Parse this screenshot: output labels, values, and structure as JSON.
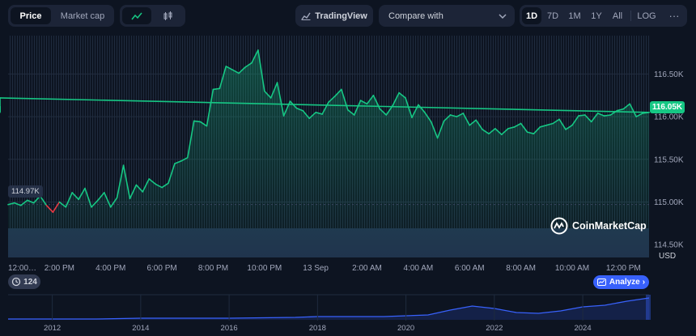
{
  "toolbar": {
    "price_tab": "Price",
    "marketcap_tab": "Market cap",
    "chart_type_line_icon": "line-chart-icon",
    "chart_type_candle_icon": "candlestick-icon",
    "tradingview_label": "TradingView",
    "compare_placeholder": "Compare with",
    "ranges": [
      "1D",
      "7D",
      "1M",
      "1Y",
      "All"
    ],
    "active_range": "1D",
    "log_label": "LOG",
    "more_icon": "more-icon"
  },
  "watermark": "CoinMarketCap",
  "history_badge": "124",
  "analyze_button": "Analyze",
  "colors": {
    "up": "#16c784",
    "down": "#ea3943",
    "background": "#0d1421",
    "volume": "#3d5a80",
    "accent": "#3861fb"
  },
  "chart_data": {
    "type": "area",
    "currency_label": "USD",
    "y_ticks": [
      "116.50K",
      "116.00K",
      "115.50K",
      "115.00K",
      "114.50K"
    ],
    "y_tick_values": [
      116500,
      116000,
      115500,
      115000,
      114500
    ],
    "ylim": [
      114350,
      116950
    ],
    "x_tick_labels": [
      "12:00…",
      "2:00 PM",
      "4:00 PM",
      "6:00 PM",
      "8:00 PM",
      "10:00 PM",
      "13 Sep",
      "2:00 AM",
      "4:00 AM",
      "6:00 AM",
      "8:00 AM",
      "10:00 AM",
      "12:00 PM"
    ],
    "x_tick_hours": [
      0,
      2,
      4,
      6,
      8,
      10,
      12,
      14,
      16,
      18,
      20,
      22,
      24
    ],
    "open_price_label": "114.97K",
    "open_price": 114970,
    "current_price_label": "116.05K",
    "current_price": 116050,
    "series": [
      {
        "hours": [
          0,
          0.25,
          0.5,
          0.75,
          1,
          1.25,
          1.5,
          1.75,
          2,
          2.25,
          2.5,
          2.75,
          3,
          3.25,
          3.5,
          3.75,
          4,
          4.25,
          4.5,
          4.75,
          5,
          5.25,
          5.5,
          5.75,
          6,
          6.25,
          6.5,
          6.75,
          7,
          7.25,
          7.5,
          7.75,
          8,
          8.25,
          8.5,
          8.75,
          9,
          9.25,
          9.5,
          9.75,
          10,
          10.25,
          10.5,
          10.75,
          11,
          11.25,
          11.5,
          11.75,
          12,
          12.25,
          12.5,
          12.75,
          13,
          13.25,
          13.5,
          13.75,
          14,
          14.25,
          14.5,
          14.75,
          15,
          15.25,
          15.5,
          15.75,
          16,
          16.25,
          16.5,
          16.75,
          17,
          17.25,
          17.5,
          17.75,
          18,
          18.25,
          18.5,
          18.75,
          19,
          19.25,
          19.5,
          19.75,
          20,
          20.25,
          20.5,
          20.75,
          21,
          21.25,
          21.5,
          21.75,
          22,
          22.25,
          22.5,
          22.75,
          23,
          23.25,
          23.5,
          23.75,
          24,
          24.25,
          24.5,
          24.75,
          25
        ],
        "values": [
          114970,
          114990,
          114960,
          115020,
          114990,
          115070,
          114960,
          114880,
          115000,
          114940,
          115110,
          115030,
          115160,
          114940,
          115020,
          115110,
          114940,
          115050,
          115430,
          115040,
          115200,
          115120,
          115270,
          115210,
          115170,
          115220,
          115450,
          115480,
          115520,
          115950,
          115940,
          115890,
          116320,
          116330,
          116590,
          116550,
          116510,
          116580,
          116630,
          116780,
          116300,
          116220,
          116400,
          116010,
          116180,
          116100,
          116070,
          115980,
          116050,
          116030,
          116170,
          116240,
          116320,
          116080,
          116020,
          116190,
          116150,
          116250,
          116090,
          116020,
          116130,
          116280,
          116220,
          115990,
          116140,
          116050,
          115940,
          115750,
          115950,
          116020,
          116000,
          116040,
          115900,
          115960,
          115850,
          115800,
          115860,
          115790,
          115860,
          115880,
          115920,
          115820,
          115800,
          115880,
          115900,
          115920,
          115970,
          115850,
          115900,
          116010,
          116020,
          115940,
          116040,
          116010,
          116020,
          116070,
          116090,
          116150,
          116000,
          116040,
          116050,
          116220,
          116060,
          116120,
          116050
        ]
      }
    ],
    "overview_x_ticks": [
      "2012",
      "2014",
      "2016",
      "2018",
      "2020",
      "2022",
      "2024"
    ]
  }
}
